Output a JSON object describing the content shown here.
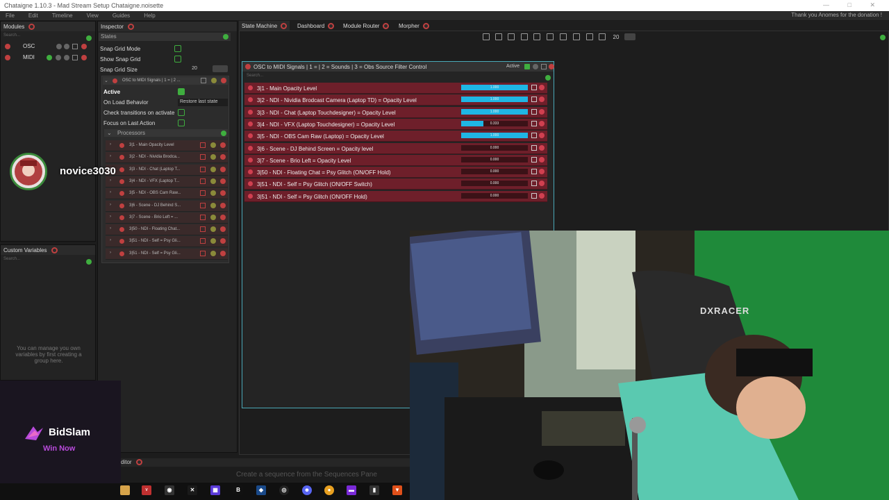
{
  "window": {
    "title": "Chataigne 1.10.3 - Mad Stream Setup Chataigne.noisette",
    "controls": "— □ ✕"
  },
  "menu": [
    "File",
    "Edit",
    "Timeline",
    "View",
    "Guides",
    "Help"
  ],
  "donation": "Thank you Anomes for the donation !",
  "modules": {
    "title": "Modules",
    "search": "Search...",
    "items": [
      {
        "name": "OSC"
      },
      {
        "name": "MIDI"
      }
    ]
  },
  "custom_variables": {
    "title": "Custom Variables",
    "search": "Search...",
    "hint": "You can manage you own variables by first creating a group here."
  },
  "inspector": {
    "title": "Inspector",
    "states_label": "States",
    "snap_grid_mode": "Snap Grid Mode",
    "show_snap_grid": "Show Snap Grid",
    "snap_grid_size": "Snap Grid Size",
    "snap_grid_size_value": "20",
    "state_title": "OSC to MIDI Signals | 1 = | 2 ...",
    "active": "Active",
    "on_load_behavior": "On Load Behavior",
    "on_load_value": "Restore last state",
    "check_transitions": "Check transitions on activate",
    "focus_last_action": "Focus on Last Action",
    "processors": "Processors",
    "processor_items": [
      "3|1 - Main Opacity Level",
      "3|2 - NDI - Nividia Brodca...",
      "3|3 - NDI - Chat (Laptop T...",
      "3|4 - NDI - VFX (Laptop T...",
      "3|5 - NDI - OBS Cam Raw...",
      "3|6 - Scene - DJ Behind S...",
      "3|7 - Scene - Brio Left = ...",
      "3|50 - NDI - Floating Chat...",
      "3|51 - NDI - Self = Psy Gli...",
      "3|51 - NDI - Self = Psy Gli..."
    ]
  },
  "tabs": [
    "State Machine",
    "Dashboard",
    "Module Router",
    "Morpher"
  ],
  "toolbar": {
    "grid_value": "20"
  },
  "state_window": {
    "title": "OSC to MIDI Signals | 1 =   | 2 = Sounds | 3 = Obs Source Filter Control",
    "active_label": "Active",
    "search": "Search...",
    "rows": [
      {
        "label": "3|1 - Main Opacity Level",
        "value": 1.0,
        "display": "1.000"
      },
      {
        "label": "3|2 - NDI - Nividia Brodcast Camera (Laptop TD) = Opacity Level",
        "value": 1.0,
        "display": "1.000"
      },
      {
        "label": "3|3 - NDI - Chat (Laptop Touchdesigner) = Opacity Level",
        "value": 1.0,
        "display": "1.000"
      },
      {
        "label": "3|4 - NDI - VFX (Laptop Touchdesigner) = Opacity Level",
        "value": 0.333,
        "display": "0.333"
      },
      {
        "label": "3|5 - NDI - OBS Cam Raw (Laptop) = Opacity Level",
        "value": 1.0,
        "display": "1.000"
      },
      {
        "label": "3|6 - Scene - DJ Behind Screen = Opacity level",
        "value": 0,
        "display": "0.000"
      },
      {
        "label": "3|7 - Scene - Brio Left = Opacity Level",
        "value": 0,
        "display": "0.000"
      },
      {
        "label": "3|50 - NDI - Floating Chat = Psy Glitch (ON/OFF Hold)",
        "value": 0,
        "display": "0.000"
      },
      {
        "label": "3|51 - NDI - Self = Psy Glitch (ON/OFF Switch)",
        "value": 0,
        "display": "0.000"
      },
      {
        "label": "3|51 - NDI - Self = Psy Glitch (ON/OFF Hold)",
        "value": 0,
        "display": "0.000"
      }
    ]
  },
  "sequence_editor": {
    "title": "ditor",
    "hint": "Create a sequence from the Sequences Pane"
  },
  "overlay": {
    "username": "novice3030",
    "brand": "BidSlam",
    "cta": "Win Now",
    "chair_brand": "DXRACER"
  },
  "colors": {
    "accent": "#1fb6e4",
    "state_row": "#6e1f2a",
    "green": "#3fae3f",
    "close": "#c04040",
    "window_border": "#4aa9b8"
  }
}
